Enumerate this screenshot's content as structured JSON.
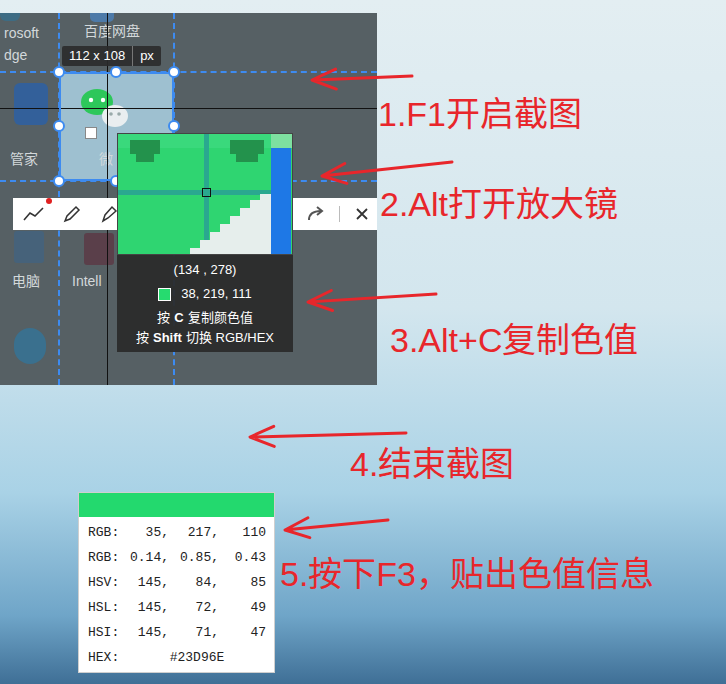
{
  "desktop": {
    "labels": [
      "rosoft",
      "dge",
      "百度网盘",
      "管家",
      "微",
      "电脑",
      "Intell"
    ]
  },
  "selection": {
    "size": "112 x 108",
    "unit": "px"
  },
  "magnifier": {
    "coords": "(134 , 278)",
    "rgb": "38, 219, 111",
    "color": "#26DB6F",
    "hints": [
      {
        "prefix": "按",
        "key": "C",
        "text": "复制颜色值"
      },
      {
        "prefix": "按",
        "key": "Shift",
        "text": "切换 RGB/HEX"
      }
    ]
  },
  "annotations": [
    "1.F1开启截图",
    "2.Alt打开放大镜",
    "3.Alt+C复制色值",
    "4.结束截图",
    "5.按下F3，贴出色值信息"
  ],
  "color_card": {
    "color": "#23D96E",
    "rows": [
      {
        "label": "RGB:",
        "values": [
          "35,",
          "217,",
          "110"
        ]
      },
      {
        "label": "RGB:",
        "values": [
          "0.14,",
          "0.85,",
          "0.43"
        ]
      },
      {
        "label": "HSV:",
        "values": [
          "145,",
          "84,",
          "85"
        ]
      },
      {
        "label": "HSL:",
        "values": [
          "145,",
          "72,",
          "49"
        ]
      },
      {
        "label": "HSI:",
        "values": [
          "145,",
          "71,",
          "47"
        ]
      },
      {
        "label": "HEX:",
        "values": [
          "#23D96E"
        ]
      }
    ]
  }
}
